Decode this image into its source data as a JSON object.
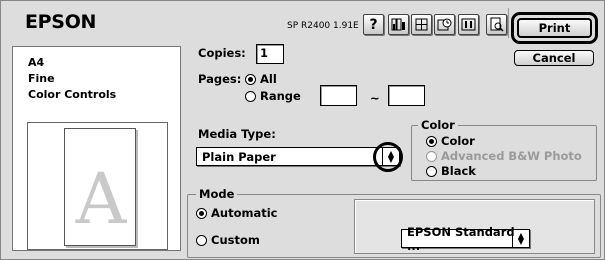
{
  "header": {
    "brand": "EPSON",
    "model": "SP R2400 1.91E"
  },
  "toolbar": {
    "icons": [
      "help-icon",
      "ink-levels-icon",
      "page-setup-icon",
      "background-print-icon",
      "layout-icon",
      "preview-icon"
    ],
    "help_glyph": "?"
  },
  "actions": {
    "print_label": "Print",
    "cancel_label": "Cancel"
  },
  "summary": {
    "paper_size": "A4",
    "quality": "Fine",
    "color_mode": "Color Controls",
    "preview_letter": "A"
  },
  "copies": {
    "label": "Copies:",
    "value": "1"
  },
  "pages": {
    "label": "Pages:",
    "all_label": "All",
    "range_label": "Range",
    "range_separator": "~",
    "selected": "All",
    "from": "",
    "to": ""
  },
  "media": {
    "label": "Media Type:",
    "value": "Plain Paper"
  },
  "color": {
    "title": "Color",
    "options": [
      "Color",
      "Advanced B&W Photo",
      "Black"
    ],
    "selected": "Color"
  },
  "mode": {
    "title": "Mode",
    "options": [
      "Automatic",
      "Custom"
    ],
    "selected": "Automatic",
    "custom_setting": "EPSON Standard ..."
  }
}
